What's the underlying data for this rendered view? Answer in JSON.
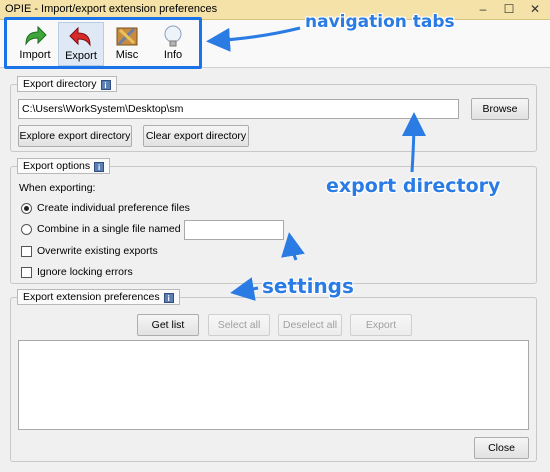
{
  "window": {
    "title": "OPIE - Import/export extension preferences"
  },
  "titlebar_buttons": {
    "minimize": "–",
    "maximize": "☐",
    "close": "✕"
  },
  "tabs": [
    {
      "label": "Import",
      "icon": "import-arrow-icon",
      "active": false
    },
    {
      "label": "Export",
      "icon": "export-arrow-icon",
      "active": true
    },
    {
      "label": "Misc",
      "icon": "tools-icon",
      "active": false
    },
    {
      "label": "Info",
      "icon": "lightbulb-icon",
      "active": false
    }
  ],
  "export_directory": {
    "header": "Export directory",
    "info_icon": "i",
    "path_value": "C:\\Users\\WorkSystem\\Desktop\\sm",
    "browse_label": "Browse",
    "explore_label": "Explore export directory",
    "clear_label": "Clear export directory"
  },
  "export_options": {
    "header": "Export options",
    "info_icon": "i",
    "when_label": "When exporting:",
    "radio_individual": "Create individual preference files",
    "radio_single": "Combine in a single file named",
    "single_file_value": "",
    "overwrite_label": "Overwrite existing exports",
    "ignore_label": "Ignore locking errors",
    "radio_selected": "individual",
    "overwrite_checked": false,
    "ignore_checked": false
  },
  "export_prefs": {
    "header": "Export extension preferences",
    "info_icon": "i",
    "get_list": "Get list",
    "select_all": "Select all",
    "deselect_all": "Deselect all",
    "export": "Export"
  },
  "close_label": "Close",
  "annotations": {
    "navigation_tabs": "navigation tabs",
    "export_directory": "export directory",
    "settings": "settings",
    "color": "#2a7be4"
  }
}
